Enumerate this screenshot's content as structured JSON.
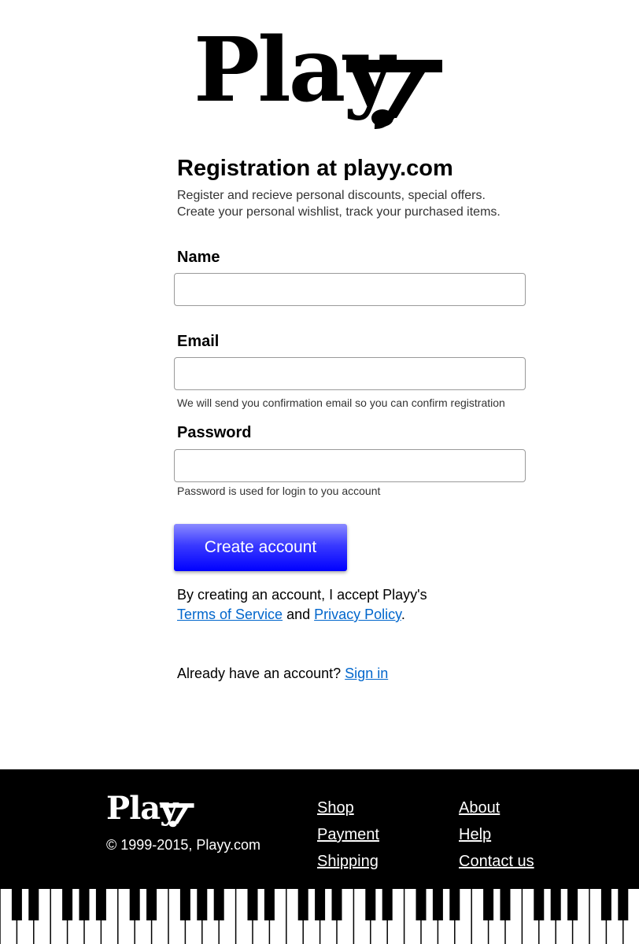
{
  "brand": {
    "logo_text": "Play",
    "logo_icon": "music-note-icon"
  },
  "page": {
    "title": "Registration at playy.com",
    "intro_line1": "Register and recieve personal discounts, special offers.",
    "intro_line2": "Create your personal wishlist, track your purchased items."
  },
  "form": {
    "name": {
      "label": "Name",
      "value": "",
      "placeholder": ""
    },
    "email": {
      "label": "Email",
      "value": "",
      "placeholder": "",
      "hint": "We will send you confirmation email so you can confirm registration"
    },
    "password": {
      "label": "Password",
      "value": "",
      "placeholder": "",
      "hint": "Password is used for login to you account"
    },
    "submit_label": "Create account",
    "submit_color": "#0000ff"
  },
  "terms": {
    "prefix": "By creating an account, I accept Playy's",
    "tos_link": "Terms of Service",
    "and": "and",
    "privacy_link": "Privacy Policy",
    "suffix": "."
  },
  "signin": {
    "prompt": "Already have an account?",
    "link": "Sign in"
  },
  "footer": {
    "logo_text": "Play",
    "copyright": "© 1999-2015, Playy.com",
    "col1": [
      "Shop",
      "Payment",
      "Shipping"
    ],
    "col2": [
      "About",
      "Help",
      "Contact us"
    ],
    "background": "#000000"
  },
  "colors": {
    "link": "#0066cc",
    "text": "#000000"
  }
}
